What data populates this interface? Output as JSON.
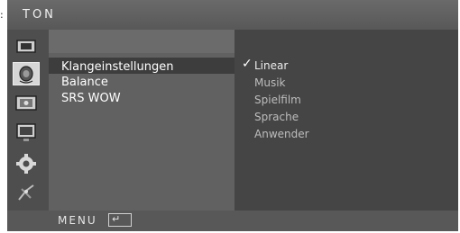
{
  "corner_mark": ":",
  "window": {
    "title": "TON"
  },
  "sidebar": {
    "icons": [
      {
        "name": "picture-icon",
        "active": false
      },
      {
        "name": "sound-icon",
        "active": true
      },
      {
        "name": "time-icon",
        "active": false
      },
      {
        "name": "display-icon",
        "active": false
      },
      {
        "name": "settings-gear-icon",
        "active": false
      },
      {
        "name": "antenna-icon",
        "active": false
      }
    ]
  },
  "main_menu": {
    "items": [
      {
        "label": "Klangeinstellungen",
        "selected": true
      },
      {
        "label": "Balance",
        "selected": false
      },
      {
        "label": "SRS WOW",
        "selected": false
      }
    ]
  },
  "submenu": {
    "check_mark": "✓",
    "items": [
      {
        "label": "Linear",
        "checked": true
      },
      {
        "label": "Musik",
        "checked": false
      },
      {
        "label": "Spielfilm",
        "checked": false
      },
      {
        "label": "Sprache",
        "checked": false
      },
      {
        "label": "Anwender",
        "checked": false
      }
    ]
  },
  "footer": {
    "menu_label": "MENU",
    "return_glyph": "↵"
  },
  "colors": {
    "osd_background": "#4a4a4a",
    "selection_bar": "#3d3d3d",
    "active_icon_bg": "#d6d6d6",
    "submenu_text": "#bdbdbd"
  }
}
